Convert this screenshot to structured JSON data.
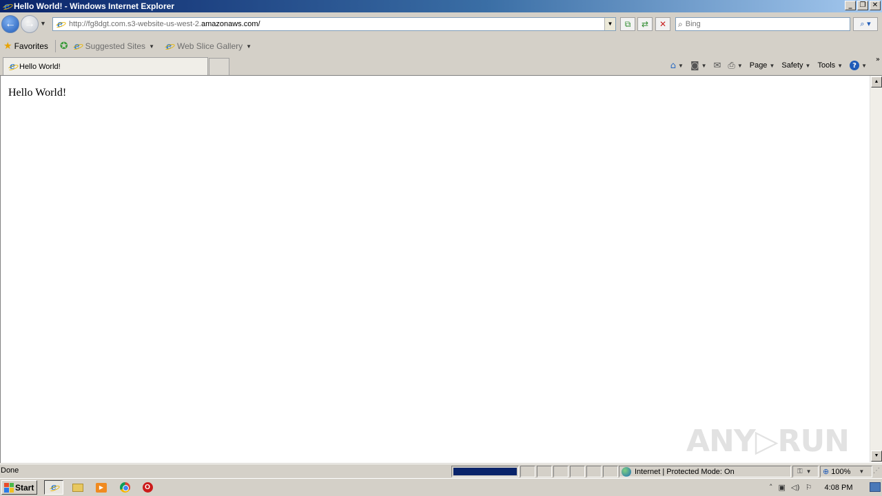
{
  "window": {
    "title": "Hello World! - Windows Internet Explorer",
    "min_glyph": "_",
    "restore_glyph": "❐",
    "close_glyph": "✕"
  },
  "navbar": {
    "back_icon": "back-arrow-icon",
    "forward_icon": "forward-arrow-icon",
    "address_prefix": "http://fg8dgt.com.s3-website-us-west-2.",
    "address_domain": "amazonaws.com",
    "address_suffix": "/",
    "search_placeholder": "Bing"
  },
  "favbar": {
    "favorites_label": "Favorites",
    "suggested_sites_label": "Suggested Sites",
    "web_slice_label": "Web Slice Gallery"
  },
  "tabs": [
    {
      "label": "Hello World!"
    }
  ],
  "commandbar": {
    "page_label": "Page",
    "safety_label": "Safety",
    "tools_label": "Tools"
  },
  "page": {
    "body_text": "Hello World!"
  },
  "watermark": "ANY▷RUN",
  "statusbar": {
    "status_text": "Done",
    "progress": 1.0,
    "zone_text": "Internet | Protected Mode: On",
    "zoom_text": "100%"
  },
  "taskbar": {
    "start_label": "Start",
    "clock": "4:08 PM"
  },
  "colors": {
    "titlebar_start": "#0a246a",
    "titlebar_end": "#a6caf0",
    "progress_fill": "#0a246a"
  }
}
